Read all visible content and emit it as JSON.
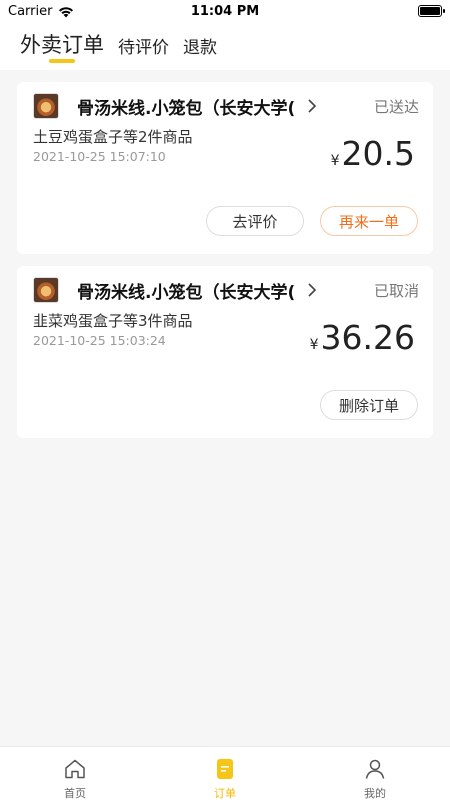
{
  "status_bar": {
    "carrier": "Carrier",
    "time": "11:04 PM"
  },
  "top_tabs": [
    {
      "label": "外卖订单",
      "active": true
    },
    {
      "label": "待评价",
      "active": false
    },
    {
      "label": "退款",
      "active": false
    }
  ],
  "orders": [
    {
      "shop_name": "骨汤米线.小笼包（长安大学(",
      "status": "已送达",
      "items": "土豆鸡蛋盒子等2件商品",
      "time": "2021-10-25 15:07:10",
      "currency": "¥",
      "price": "20.5",
      "buttons": [
        "去评价",
        "再来一单"
      ]
    },
    {
      "shop_name": "骨汤米线.小笼包（长安大学(",
      "status": "已取消",
      "items": "韭菜鸡蛋盒子等3件商品",
      "time": "2021-10-25 15:03:24",
      "currency": "¥",
      "price": "36.26",
      "buttons": [
        "删除订单"
      ]
    }
  ],
  "bottom_nav": [
    {
      "label": "首页",
      "icon": "home-icon",
      "active": false
    },
    {
      "label": "订单",
      "icon": "order-icon",
      "active": true
    },
    {
      "label": "我的",
      "icon": "profile-icon",
      "active": false
    }
  ],
  "colors": {
    "accent_yellow": "#f5c518",
    "reorder_orange": "#f0701a",
    "background": "#f6f6f6"
  }
}
